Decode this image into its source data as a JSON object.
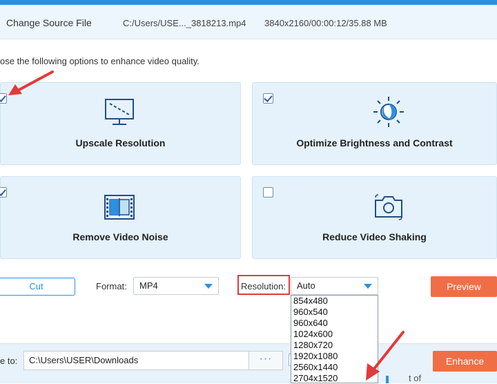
{
  "header": {
    "change_source_label": "Change Source File",
    "file_path": "C:/Users/USE..._3818213.mp4",
    "file_meta": "3840x2160/00:00:12/35.88 MB"
  },
  "instruction": "ose the following options to enhance video quality.",
  "options": [
    {
      "label": "Upscale Resolution",
      "checked": true,
      "icon": "monitor-icon"
    },
    {
      "label": "Optimize Brightness and Contrast",
      "checked": true,
      "icon": "brightness-icon"
    },
    {
      "label": "Remove Video Noise",
      "checked": true,
      "icon": "film-icon"
    },
    {
      "label": "Reduce Video Shaking",
      "checked": false,
      "icon": "camera-icon"
    }
  ],
  "controls": {
    "cut_label": "Cut",
    "format_label": "Format:",
    "format_value": "MP4",
    "resolution_label": "Resolution:",
    "resolution_value": "Auto",
    "preview_label": "Preview",
    "enhance_label": "Enhance"
  },
  "resolution_options": [
    "854x480",
    "960x540",
    "960x640",
    "1024x600",
    "1280x720",
    "1920x1080",
    "2560x1440",
    "2704x1520"
  ],
  "save": {
    "label": "e to:",
    "path": "C:\\Users\\USER\\Downloads",
    "browse_label": "···"
  },
  "background_text": "t of",
  "colors": {
    "accent": "#2e8fde",
    "orange": "#f06e45",
    "annotation_red": "#e23a3a",
    "card_bg": "#e5f2fb"
  }
}
